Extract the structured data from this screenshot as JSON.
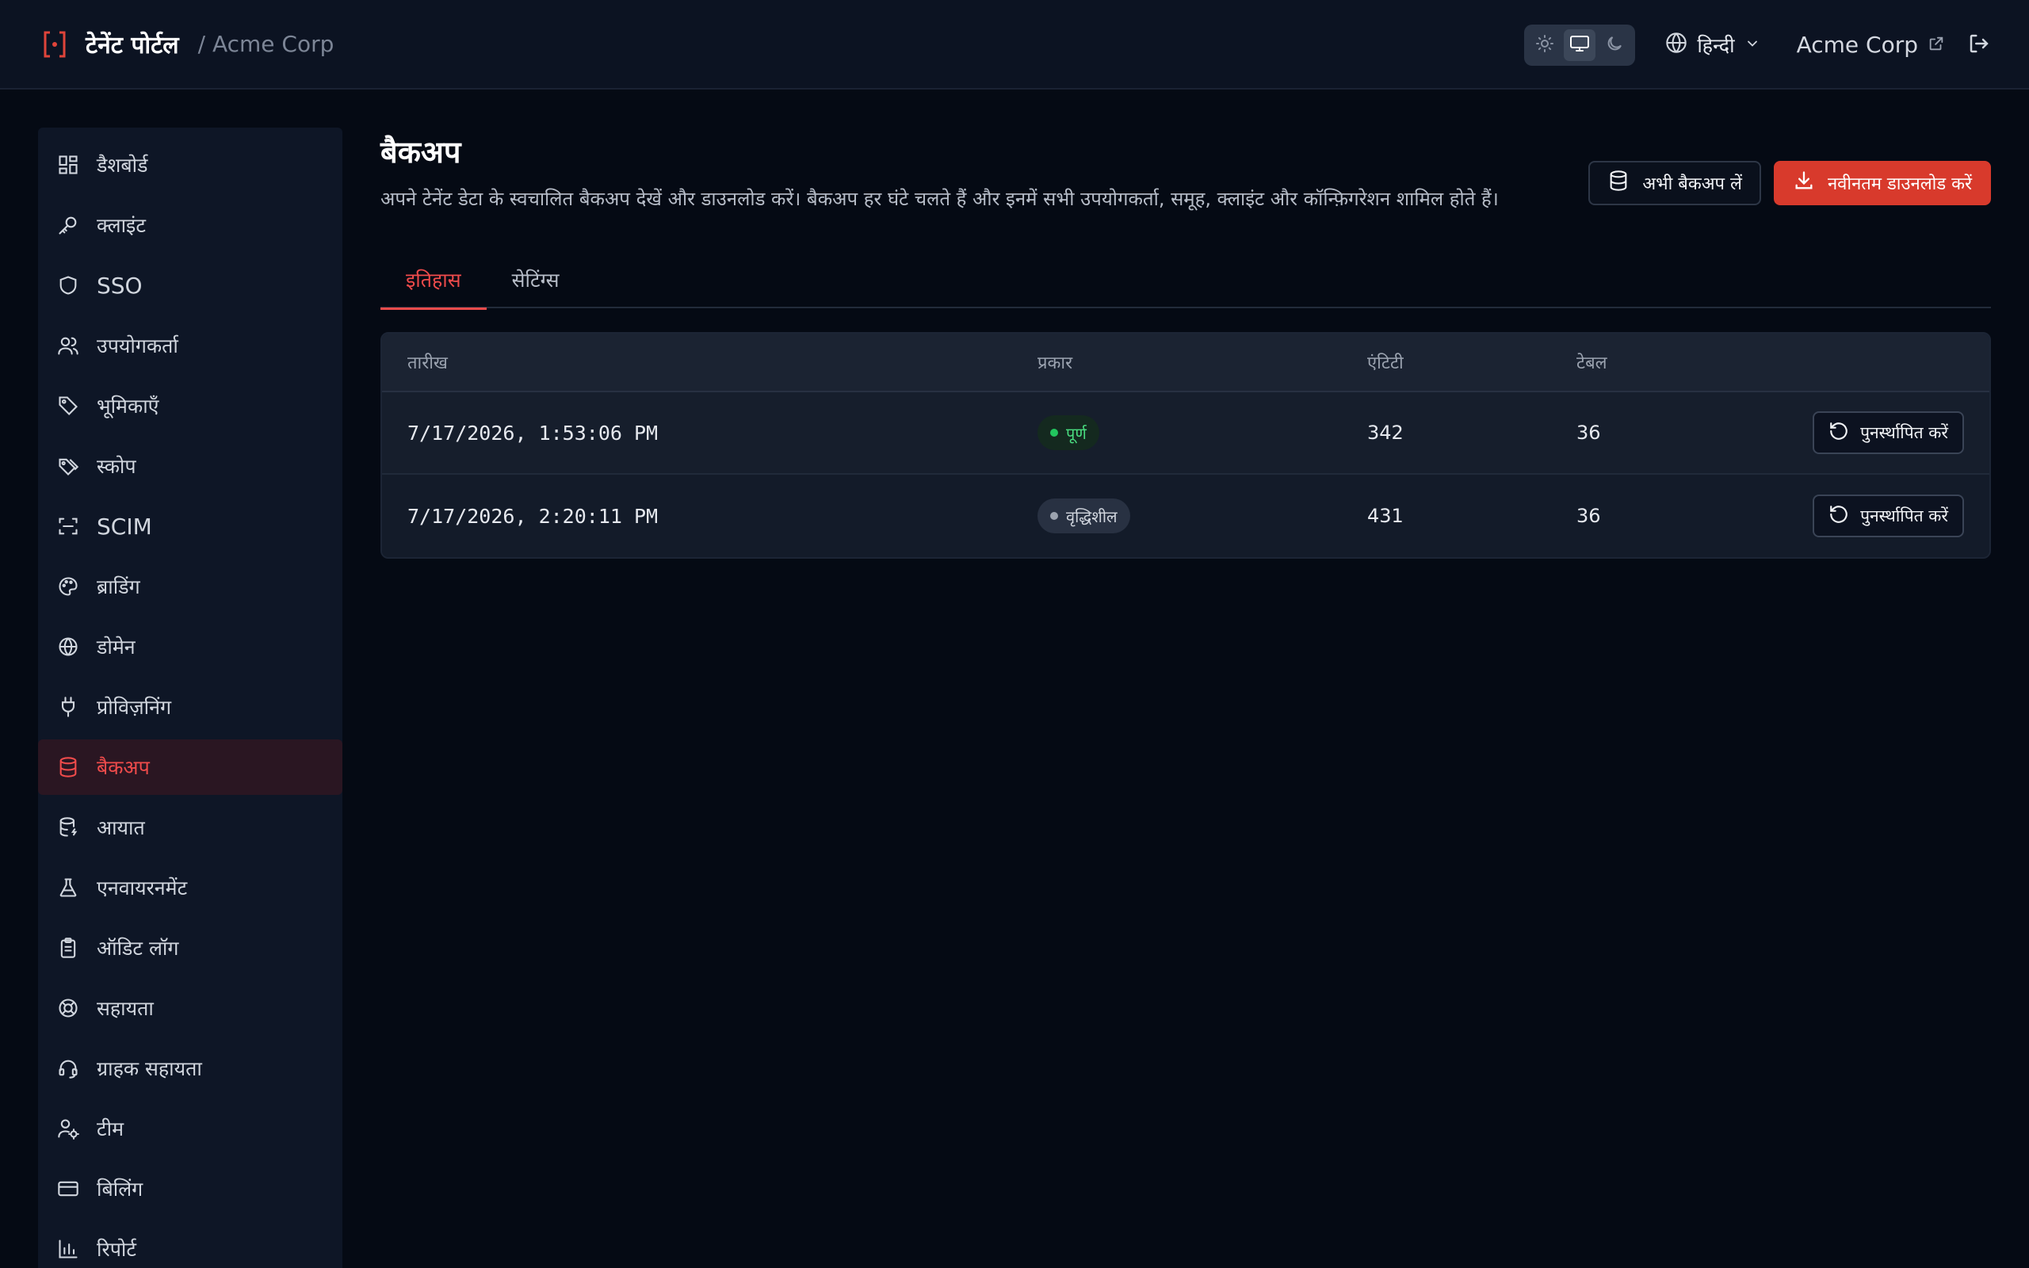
{
  "header": {
    "app_title": "टेनेंट पोर्टल",
    "org_breadcrumb": "/ Acme Corp",
    "language": "हिन्दी",
    "org_name": "Acme Corp",
    "theme_options": [
      "sun-icon",
      "monitor-icon",
      "moon-icon"
    ],
    "theme_selected": "system"
  },
  "sidebar": {
    "items": [
      {
        "label": "डैशबोर्ड",
        "icon": "dashboard-icon"
      },
      {
        "label": "क्लाइंट",
        "icon": "key-icon"
      },
      {
        "label": "SSO",
        "icon": "shield-icon"
      },
      {
        "label": "उपयोगकर्ता",
        "icon": "users-icon"
      },
      {
        "label": "भूमिकाएँ",
        "icon": "tag-icon"
      },
      {
        "label": "स्कोप",
        "icon": "tags-icon"
      },
      {
        "label": "SCIM",
        "icon": "scan-icon"
      },
      {
        "label": "ब्राडिंग",
        "icon": "palette-icon"
      },
      {
        "label": "डोमेन",
        "icon": "globe-icon"
      },
      {
        "label": "प्रोविज़निंग",
        "icon": "plug-icon"
      },
      {
        "label": "बैकअप",
        "icon": "database-icon",
        "active": true
      },
      {
        "label": "आयात",
        "icon": "database-import-icon"
      },
      {
        "label": "एनवायरनमेंट",
        "icon": "flask-icon"
      },
      {
        "label": "ऑडिट लॉग",
        "icon": "clipboard-icon"
      },
      {
        "label": "सहायता",
        "icon": "lifebuoy-icon"
      },
      {
        "label": "ग्राहक सहायता",
        "icon": "headset-icon"
      },
      {
        "label": "टीम",
        "icon": "user-cog-icon"
      },
      {
        "label": "बिलिंग",
        "icon": "credit-card-icon"
      },
      {
        "label": "रिपोर्ट",
        "icon": "bar-chart-icon"
      }
    ]
  },
  "page": {
    "title": "बैकअप",
    "description": "अपने टेनेंट डेटा के स्वचालित बैकअप देखें और डाउनलोड करें। बैकअप हर घंटे चलते हैं और इनमें सभी उपयोगकर्ता, समूह, क्लाइंट और कॉन्फ़िगरेशन शामिल होते हैं।",
    "backup_now_label": "अभी बैकअप लें",
    "download_latest_label": "नवीनतम डाउनलोड करें"
  },
  "tabs": [
    {
      "label": "इतिहास",
      "active": true
    },
    {
      "label": "सेटिंग्स",
      "active": false
    }
  ],
  "table": {
    "columns": [
      "तारीख",
      "प्रकार",
      "एंटिटी",
      "टेबल",
      ""
    ],
    "rows": [
      {
        "date": "7/17/2026, 1:53:06 PM",
        "type": "पूर्ण",
        "type_kind": "full",
        "entities": "342",
        "tables": "36",
        "action": "पुनर्स्थापित करें"
      },
      {
        "date": "7/17/2026, 2:20:11 PM",
        "type": "वृद्धिशील",
        "type_kind": "incremental",
        "entities": "431",
        "tables": "36",
        "action": "पुनर्स्थापित करें"
      }
    ]
  },
  "colors": {
    "accent": "#ef4b4b",
    "primary_button": "#d83a2c",
    "success": "#22c55e",
    "background": "#050a14"
  }
}
